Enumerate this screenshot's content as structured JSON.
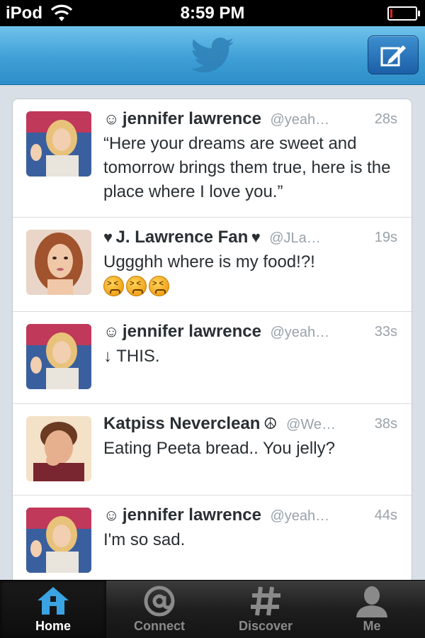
{
  "status_bar": {
    "carrier": "iPod",
    "time": "8:59 PM",
    "battery_level": 0.1
  },
  "nav_bar": {
    "logo_icon": "twitter-bird-icon",
    "compose_icon": "compose-icon",
    "colors": {
      "bar": "#3f9fd6",
      "compose": "#1b5fa6"
    }
  },
  "tweets": [
    {
      "name_prefix": "☺",
      "name": "jennifer lawrence",
      "name_suffix": "",
      "handle": "@yeah…",
      "time": "28s",
      "text": "“Here your dreams are sweet and tomorrow brings them true, here is the place where I love you.”",
      "emoji_count": 0
    },
    {
      "name_prefix": "♥",
      "name": "J. Lawrence Fan",
      "name_suffix": "♥",
      "handle": "@JLa…",
      "time": "19s",
      "text": "Uggghh where is my food!?!",
      "emoji_count": 3
    },
    {
      "name_prefix": "☺",
      "name": "jennifer lawrence",
      "name_suffix": "",
      "handle": "@yeah…",
      "time": "33s",
      "text": "↓ THIS.",
      "emoji_count": 0
    },
    {
      "name_prefix": "",
      "name": "Katpiss Neverclean",
      "name_suffix": "☮",
      "handle": "@We…",
      "time": "38s",
      "text": "Eating Peeta bread.. You jelly?",
      "emoji_count": 0
    },
    {
      "name_prefix": "☺",
      "name": "jennifer lawrence",
      "name_suffix": "",
      "handle": "@yeah…",
      "time": "44s",
      "text": "I'm so sad.",
      "emoji_count": 0
    }
  ],
  "tab_bar": {
    "tabs": [
      {
        "label": "Home",
        "icon": "home-icon",
        "selected": true
      },
      {
        "label": "Connect",
        "icon": "at-sign-icon",
        "selected": false
      },
      {
        "label": "Discover",
        "icon": "hashtag-icon",
        "selected": false
      },
      {
        "label": "Me",
        "icon": "person-icon",
        "selected": false
      }
    ]
  }
}
